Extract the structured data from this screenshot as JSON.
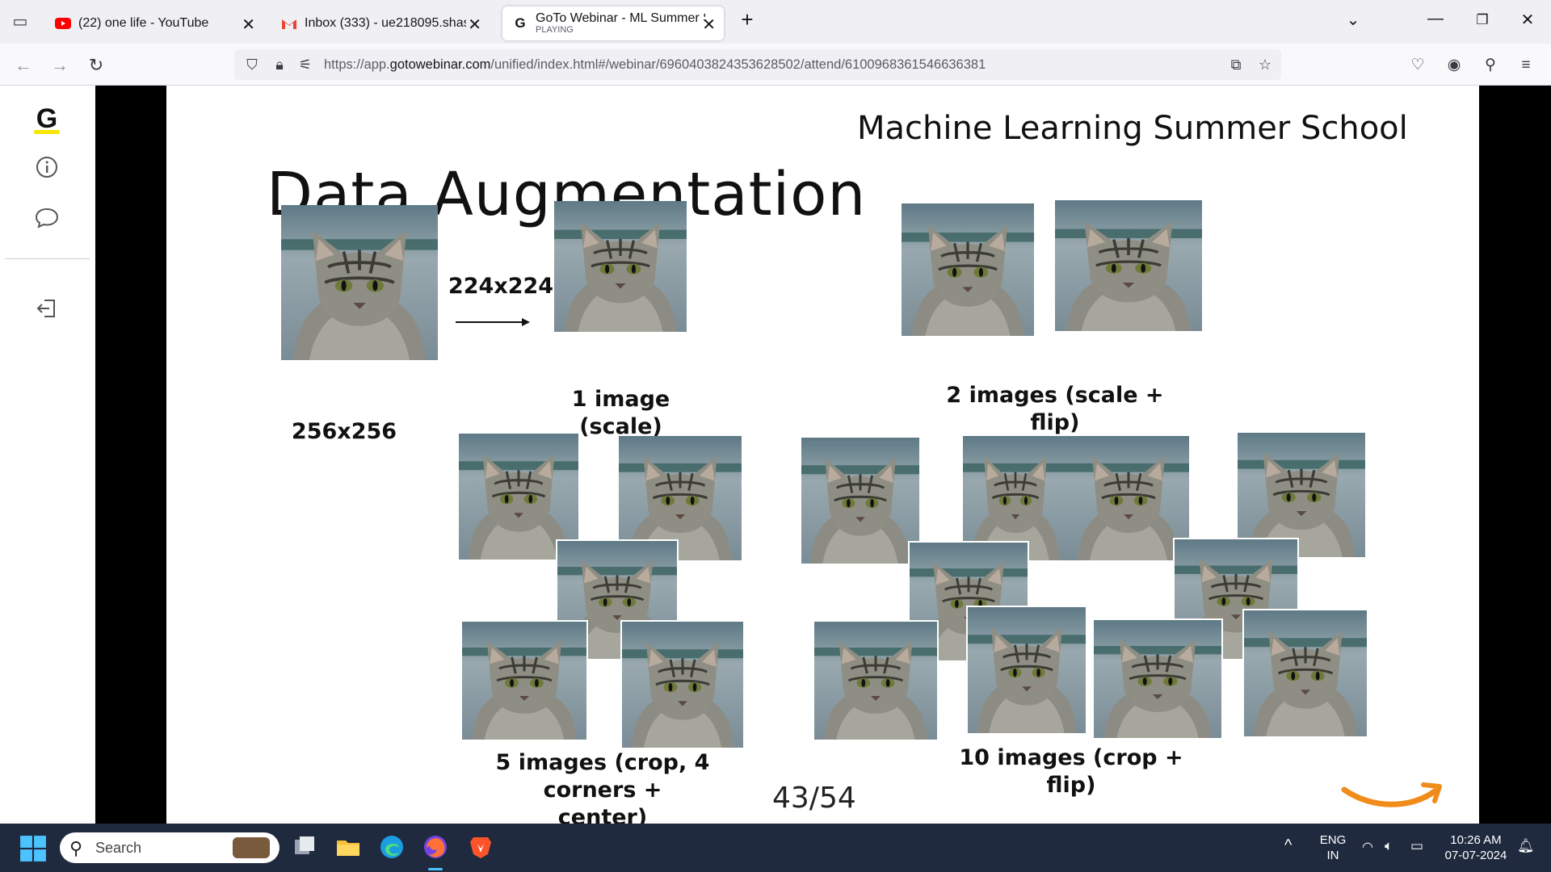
{
  "browser": {
    "tabs": [
      {
        "title": "(22) one life - YouTube",
        "icon": "youtube-icon",
        "active": false
      },
      {
        "title": "Inbox (333) - ue218095.shashan",
        "icon": "gmail-icon",
        "active": false
      },
      {
        "title": "GoTo Webinar - ML Summer Sc",
        "subtitle": "PLAYING",
        "icon": "goto-icon",
        "active": true
      }
    ],
    "new_tab_label": "+",
    "url_prefix": "https://app.",
    "url_domain": "gotowebinar.com",
    "url_path": "/unified/index.html#/webinar/6960403824353628502/attend/6100968361546636381"
  },
  "slide": {
    "header": "Machine Learning Summer School",
    "title": "Data Augmentation",
    "labels": {
      "original_size": "256x256",
      "crop_size": "224x224",
      "one_image": "1 image\n(scale)",
      "two_images": "2 images (scale +\nflip)",
      "five_images": "5 images (crop, 4 corners +\ncenter)",
      "ten_images": "10 images (crop + flip)"
    },
    "page": "43/54"
  },
  "taskbar": {
    "search_label": "Search",
    "lang_top": "ENG",
    "lang_bottom": "IN",
    "time": "10:26 AM",
    "date": "07-07-2024"
  },
  "colors": {
    "taskbar_bg": "#1f2a3e",
    "amazon_orange": "#f08c1a",
    "youtube_red": "#ff0000"
  }
}
